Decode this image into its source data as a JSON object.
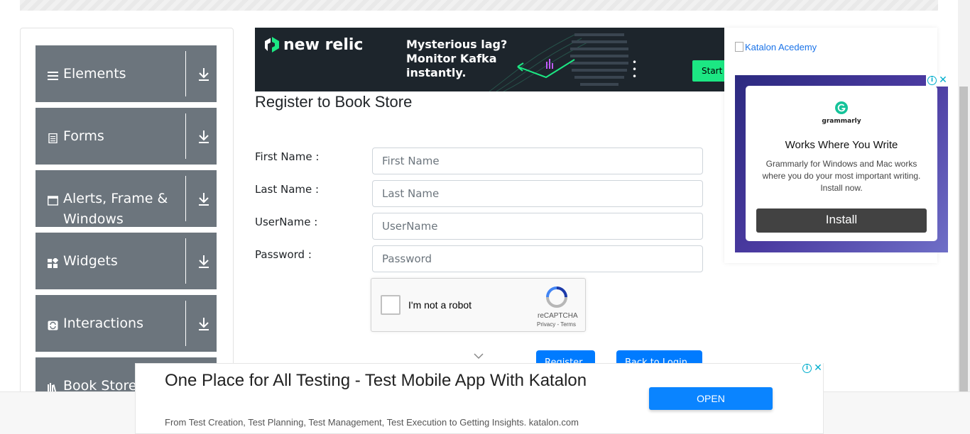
{
  "sidebar": {
    "groups": [
      {
        "label": "Elements",
        "icon": "hamburger-icon"
      },
      {
        "label": "Forms",
        "icon": "document-icon"
      },
      {
        "label": "Alerts, Frame & Windows",
        "icon": "window-icon"
      },
      {
        "label": "Widgets",
        "icon": "widgets-icon"
      },
      {
        "label": "Interactions",
        "icon": "interactions-icon"
      },
      {
        "label": "Book Store",
        "icon": "books-icon"
      }
    ]
  },
  "top_banner": {
    "brand": "new relic",
    "headline": "Mysterious lag? Monitor Kafka instantly.",
    "cta": "Start f"
  },
  "form": {
    "title": "Register to Book Store",
    "fields": [
      {
        "label": "First Name :",
        "placeholder": "First Name"
      },
      {
        "label": "Last Name :",
        "placeholder": "Last Name"
      },
      {
        "label": "UserName :",
        "placeholder": "UserName"
      },
      {
        "label": "Password :",
        "placeholder": "Password"
      }
    ],
    "captcha": {
      "text": "I'm not a robot",
      "brand": "reCAPTCHA",
      "terms": "Privacy - Terms"
    },
    "register_label": "Register",
    "back_label": "Back to Login"
  },
  "side_ad": {
    "academy_alt": "Katalon Acedemy",
    "brand": "grammarly",
    "headline": "Works Where You Write",
    "body": "Grammarly for Windows and Mac works where you do your most important writing. Install now.",
    "button": "Install"
  },
  "bottom_ad": {
    "headline": "One Place for All Testing - Test Mobile App With Katalon",
    "subtext": "From Test Creation, Test Planning, Test Management, Test Execution to Getting Insights. katalon.com",
    "button": "OPEN"
  },
  "colors": {
    "sidebar_group_bg": "#6c757d",
    "primary_button": "#007bff",
    "banner_bg": "#1d252c",
    "banner_accent": "#1ce783",
    "grammarly_green": "#15c39a"
  }
}
